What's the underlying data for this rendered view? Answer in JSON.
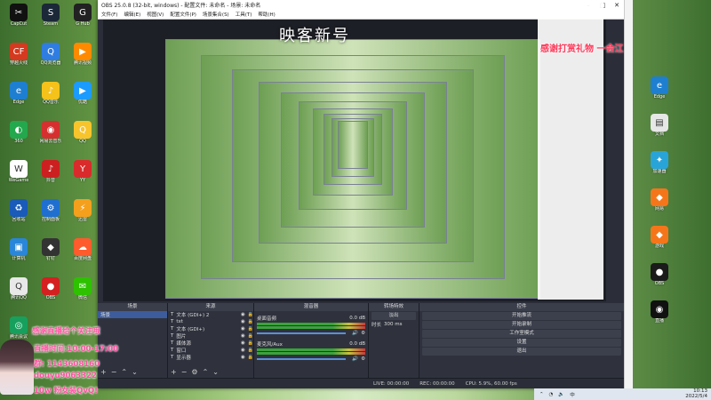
{
  "desktop_left": [
    {
      "label": "CapCut",
      "icon": "capcut-icon",
      "color": "#111111",
      "glyph": "✂"
    },
    {
      "label": "Steam",
      "icon": "steam-icon",
      "color": "#1b2838",
      "glyph": "S"
    },
    {
      "label": "G Hub",
      "icon": "ghub-icon",
      "color": "#222222",
      "glyph": "G"
    },
    {
      "label": "穿越火线",
      "icon": "crossfire-icon",
      "color": "#d43a1f",
      "glyph": "CF"
    },
    {
      "label": "QQ浏览器",
      "icon": "qq-browser-icon",
      "color": "#2f7de1",
      "glyph": "Q"
    },
    {
      "label": "腾讯视频",
      "icon": "video-icon",
      "color": "#ff8a00",
      "glyph": "▶"
    },
    {
      "label": "Edge",
      "icon": "edge-icon",
      "color": "#1e7fd1",
      "glyph": "e"
    },
    {
      "label": "QQ音乐",
      "icon": "music-icon",
      "color": "#f4c21a",
      "glyph": "♪"
    },
    {
      "label": "优酷",
      "icon": "youku-icon",
      "color": "#1c9bff",
      "glyph": "▶"
    },
    {
      "label": "360",
      "icon": "shield360-icon",
      "color": "#23a84d",
      "glyph": "◐"
    },
    {
      "label": "网易云音乐",
      "icon": "netease-icon",
      "color": "#d62f2f",
      "glyph": "◉"
    },
    {
      "label": "QQ",
      "icon": "qq-icon",
      "color": "#f7c42b",
      "glyph": "Q"
    },
    {
      "label": "WeGame",
      "icon": "wegame-icon",
      "color": "#ffffff",
      "glyph": "W"
    },
    {
      "label": "抖音",
      "icon": "douyin-icon",
      "color": "#cc2020",
      "glyph": "♪"
    },
    {
      "label": "YY",
      "icon": "yy-icon",
      "color": "#d92b2b",
      "glyph": "Y"
    },
    {
      "label": "回收站",
      "icon": "recycle-bin-icon",
      "color": "#1a5ab8",
      "glyph": "♻"
    },
    {
      "label": "控制面板",
      "icon": "control-panel-icon",
      "color": "#1f6fd0",
      "glyph": "⚙"
    },
    {
      "label": "迅雷",
      "icon": "thunder-icon",
      "color": "#f4a01d",
      "glyph": "⚡"
    },
    {
      "label": "计算机",
      "icon": "computer-icon",
      "color": "#2a86d8",
      "glyph": "▣"
    },
    {
      "label": "钉钉",
      "icon": "dingtalk-icon",
      "color": "#333333",
      "glyph": "◆"
    },
    {
      "label": "百度网盘",
      "icon": "netdisk-icon",
      "color": "#ff5b2c",
      "glyph": "☁"
    },
    {
      "label": "腾讯QQ",
      "icon": "tencent-qq-icon",
      "color": "#e8e8e8",
      "glyph": "Q"
    },
    {
      "label": "OBS",
      "icon": "obs-icon",
      "color": "#d42020",
      "glyph": "●"
    },
    {
      "label": "微信",
      "icon": "wechat-icon",
      "color": "#2dc100",
      "glyph": "✉"
    },
    {
      "label": "腾讯会议",
      "icon": "meeting-icon",
      "color": "#17a05d",
      "glyph": "◎"
    }
  ],
  "desktop_right": [
    {
      "label": "Edge",
      "icon": "edge-icon",
      "color": "#1e7fd1",
      "glyph": "e"
    },
    {
      "label": "文档",
      "icon": "document-icon",
      "color": "#e7e7e7",
      "glyph": "▤"
    },
    {
      "label": "加速器",
      "icon": "booster-icon",
      "color": "#29a4d9",
      "glyph": "✦"
    },
    {
      "label": "网易",
      "icon": "netease-game-icon",
      "color": "#f5761a",
      "glyph": "◆"
    },
    {
      "label": "游戏",
      "icon": "game-icon",
      "color": "#f5761a",
      "glyph": "◆"
    },
    {
      "label": "OBS",
      "icon": "obs-icon",
      "color": "#1b1b1b",
      "glyph": "●"
    },
    {
      "label": "直播",
      "icon": "live-icon",
      "color": "#111111",
      "glyph": "◉"
    }
  ],
  "obs": {
    "title": "OBS 25.0.8 (32-bit, windows) - 配置文件: 未命名 - 场景: 未命名",
    "menu": [
      "文件(F)",
      "编辑(E)",
      "视图(V)",
      "配置文件(P)",
      "场景集合(S)",
      "工具(T)",
      "帮助(H)"
    ],
    "overlay_title": "映客新号",
    "panels": {
      "scenes": "场景",
      "sources": "来源",
      "mixer": "混音器",
      "transitions": "转场特效",
      "controls": "控件"
    },
    "scenes_items": [
      "场景"
    ],
    "sources_items": [
      "文本 (GDI+) 2",
      "txt",
      "文本 (GDI+)",
      "图片",
      "媒体源",
      "窗口",
      "显示器"
    ],
    "mixer": [
      {
        "name": "桌面音频",
        "level": "0.0 dB"
      },
      {
        "name": "麦克风/Aux",
        "level": "0.0 dB"
      }
    ],
    "transition": {
      "type": "淡出",
      "duration_label": "时长",
      "duration": "300 ms"
    },
    "controls": [
      "开始推流",
      "开始录制",
      "工作室模式",
      "设置",
      "退出"
    ],
    "status": [
      "LIVE: 00:00:00",
      "REC: 00:00:00",
      "CPU: 5.9%, 60.00 fps"
    ]
  },
  "chat_lines": [
    {
      "text": "感谢直播给个关注哦"
    },
    {
      "text": "直播时间:10:00-17:00"
    },
    {
      "text": "群: 1143608160"
    },
    {
      "text": "douyu9063322"
    },
    {
      "text": "10w 粉女装QvQ!"
    }
  ],
  "right_overlay": "感谢打赏礼物 一会江",
  "taskbar": {
    "time": "10:13",
    "date": "2022/5/4"
  }
}
